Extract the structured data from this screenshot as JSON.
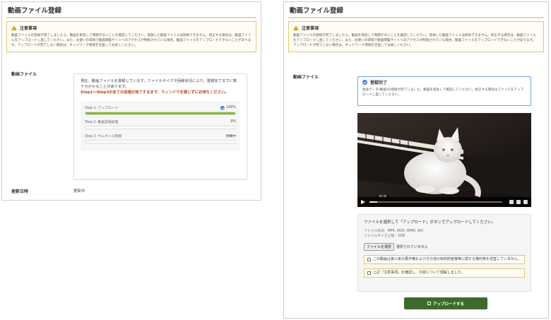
{
  "left": {
    "title": "動画ファイル登録",
    "notice_title": "注意事項",
    "notice_body": "動画ファイルの登録が完了しましたら、動画を再生して問題がないことを確認してください。登録した動画ファイルは削除できません。修正する場合は、動画ファイルをアップロードし直してください。また、お使いの環境で動画閲覧サイトへのアクセスが制限されている場合、動画ファイルをアップロードできないことがあります。アップロードが完了しない場合は、ネットワーク環境を見直してお試しください。",
    "row_video_label": "動画ファイル",
    "card_message": "現在、動画ファイルを登録しています。ファイルサイズや回線状況により、登録完了までに数十分かかることがあります。",
    "card_warning": "Step1～Step3の全ての処理が完了するまで、ウィンドウを閉じずにお待ちください。",
    "steps": [
      {
        "label": "Step 1. アップロード",
        "status": "100%",
        "progress": 1.0
      },
      {
        "label": "Step 2. 動画変換処理",
        "status": "0%",
        "progress": 0.0
      },
      {
        "label": "Step 3. サムネイル登録",
        "status": "待機中",
        "progress": 0.0
      }
    ],
    "row_updated_label": "更新日時",
    "row_updated_value": "更新中"
  },
  "right": {
    "title": "動画ファイル登録",
    "notice_title": "注意事項",
    "notice_body": "動画ファイルの登録が完了しましたら、動画を再生して問題がないことを確認してください。登録した動画ファイルは削除できません。修正する場合は、動画ファイルをアップロードし直してください。また、お使いの環境で動画閲覧サイトへのアクセスが制限されている場合、動画ファイルをアップロードできないことがあります。アップロードが完了しない場合は、ネットワーク環境を見直してお試しください。",
    "row_video_label": "動画ファイル",
    "done_title": "登録完了",
    "done_body": "発表データ(動画)の登録が完了しました。動画を再生して確認してください。修正する場合はファイルをアップロードし直してください。",
    "video_time": "00:00",
    "upload_message": "ファイルを選択して「アップロード」ボタンでアップロードしてください。",
    "file_formats": "ファイル形式：MP4, MOV, WMV, AVI",
    "file_size": "ファイルサイズ上限：1GB",
    "file_button": "ファイルを選択",
    "file_none": "選択されていません",
    "check_1": "この動画は第三者の著作権およびその他の知的財産権等に関する権利等を侵害していません。",
    "check_2": "上記「注意事項」を確認し、内容について理解しました。",
    "submit_label": "アップロードする"
  },
  "colors": {
    "accent_green": "#3d6a2d",
    "progress_green": "#86b83a",
    "notice_border": "#e4c96a",
    "done_border": "#6aa4d6"
  }
}
